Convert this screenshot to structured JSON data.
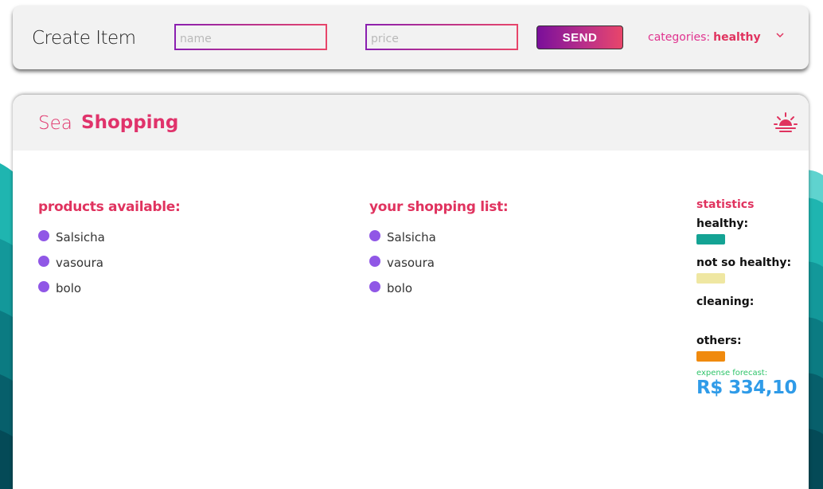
{
  "create_item": {
    "title": "Create Item",
    "name_placeholder": "name",
    "price_placeholder": "price",
    "send_label": "SEND",
    "categories_label": "categories:",
    "categories_value": "healthy"
  },
  "header": {
    "brand_light": "Sea",
    "brand_bold": "Shopping",
    "theme_icon": "sun-icon"
  },
  "products_available": {
    "title": "products available:",
    "items": [
      "Salsicha",
      "vasoura",
      "bolo"
    ]
  },
  "shopping_list": {
    "title": "your shopping list:",
    "items": [
      "Salsicha",
      "vasoura",
      "bolo"
    ]
  },
  "statistics": {
    "title": "statistics",
    "categories": [
      {
        "label": "healthy:",
        "color": "#14a394"
      },
      {
        "label": "not so healthy:",
        "color": "#efe7a2"
      },
      {
        "label": "cleaning:",
        "color": ""
      },
      {
        "label": "others:",
        "color": "#f08a0e"
      }
    ],
    "forecast_label": "expense forecast:",
    "forecast_value": "R$ 334,10"
  },
  "colors": {
    "accent": "#e0335f",
    "bullet": "#9057e6",
    "forecast": "#2f9be8",
    "forecast_label": "#2fc46a"
  }
}
